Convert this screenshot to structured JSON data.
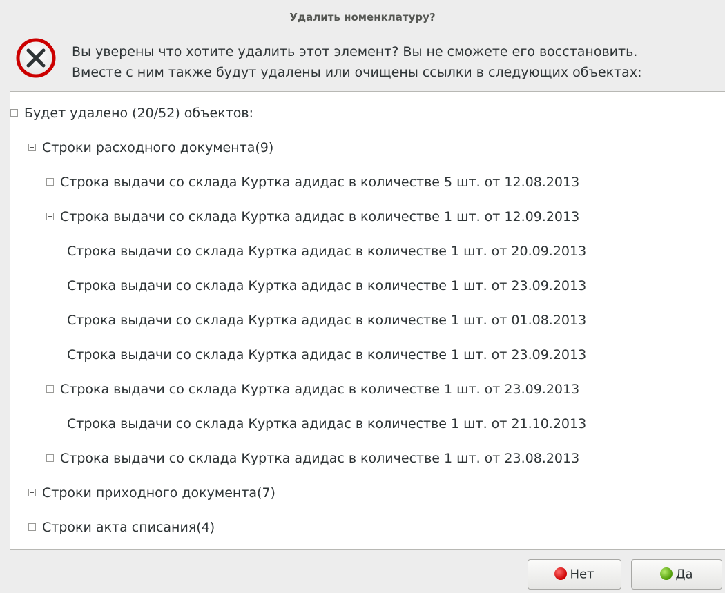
{
  "dialog": {
    "title": "Удалить номенклатуру?",
    "message_line1": "Вы уверены что хотите удалить этот элемент? Вы не сможете его восстановить.",
    "message_line2": "Вместе с ним также будут удалены или очищены ссылки в следующих объектах:",
    "icon": "error-icon"
  },
  "tree": {
    "root": {
      "label": "Будет удалено (20/52) объектов:",
      "expanded": true
    },
    "groups": [
      {
        "label": "Строки расходного документа(9)",
        "expanded": true,
        "children": [
          {
            "label": "Строка выдачи со склада Куртка адидас в количестве 5 шт. от 12.08.2013",
            "expander": "plus"
          },
          {
            "label": "Строка выдачи со склада Куртка адидас в количестве 1 шт. от 12.09.2013",
            "expander": "plus"
          },
          {
            "label": "Строка выдачи со склада Куртка адидас в количестве 1 шт. от 20.09.2013",
            "expander": "none"
          },
          {
            "label": "Строка выдачи со склада Куртка адидас в количестве 1 шт. от 23.09.2013",
            "expander": "none"
          },
          {
            "label": "Строка выдачи со склада Куртка адидас в количестве 1 шт. от 01.08.2013",
            "expander": "none"
          },
          {
            "label": "Строка выдачи со склада Куртка адидас в количестве 1 шт. от 23.09.2013",
            "expander": "none"
          },
          {
            "label": "Строка выдачи со склада Куртка адидас в количестве 1 шт. от 23.09.2013",
            "expander": "plus"
          },
          {
            "label": "Строка выдачи со склада Куртка адидас в количестве 1 шт. от 21.10.2013",
            "expander": "none"
          },
          {
            "label": "Строка выдачи со склада Куртка адидас в количестве 1 шт. от 23.08.2013",
            "expander": "plus"
          }
        ]
      },
      {
        "label": "Строки приходного документа(7)",
        "expanded": false
      },
      {
        "label": "Строки акта списания(4)",
        "expanded": false
      }
    ]
  },
  "buttons": {
    "no_label": "Нет",
    "yes_label": "Да",
    "no_color": "#cc0000",
    "yes_color": "#4e9a06"
  }
}
